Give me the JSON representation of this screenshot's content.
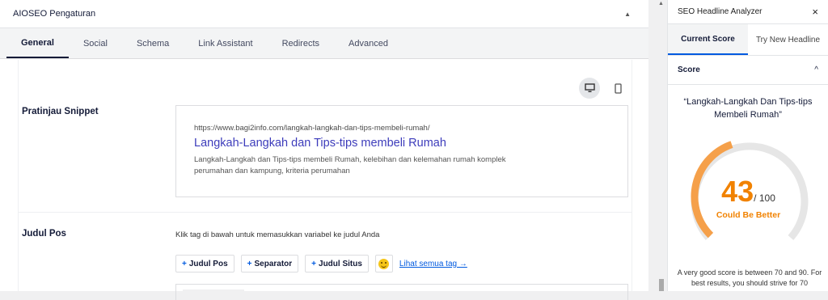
{
  "main_panel": {
    "title": "AIOSEO Pengaturan",
    "tabs": [
      "General",
      "Social",
      "Schema",
      "Link Assistant",
      "Redirects",
      "Advanced"
    ],
    "active_tab": "General"
  },
  "snippet": {
    "label": "Pratinjau Snippet",
    "url": "https://www.bagi2info.com/langkah-langkah-dan-tips-membeli-rumah/",
    "title": "Langkah-Langkah dan Tips-tips membeli Rumah",
    "description": "Langkah-Langkah dan Tips-tips membeli Rumah, kelebihan dan kelemahan rumah komplek perumahan dan kampung, kriteria perumahan"
  },
  "post_title": {
    "label": "Judul Pos",
    "hint": "Klik tag di bawah untuk memasukkan variabel ke judul Anda",
    "tags": [
      "Judul Pos",
      "Separator",
      "Judul Situs"
    ],
    "see_all": "Lihat semua tag →"
  },
  "sidebar": {
    "title": "SEO Headline Analyzer",
    "close": "×",
    "tabs": [
      "Current Score",
      "Try New Headline"
    ],
    "section": "Score",
    "headline": "“Langkah-Langkah Dan Tips-tips Membeli Rumah”",
    "score": "43",
    "score_max": "/ 100",
    "score_value": 43,
    "score_label": "Could Be Better",
    "advice": "A very good score is between 70 and 90. For best results, you should strive for 70"
  },
  "colors": {
    "gauge": "#f5a04a",
    "gauge_track": "#e6e6e6",
    "score": "#f18200",
    "link": "#3d3cbb"
  },
  "icons": {
    "desktop": "desktop-icon",
    "mobile": "mobile-icon",
    "collapse": "caret-up-icon",
    "chevron": "chevron-up-icon",
    "emoji": "smiley-icon"
  }
}
